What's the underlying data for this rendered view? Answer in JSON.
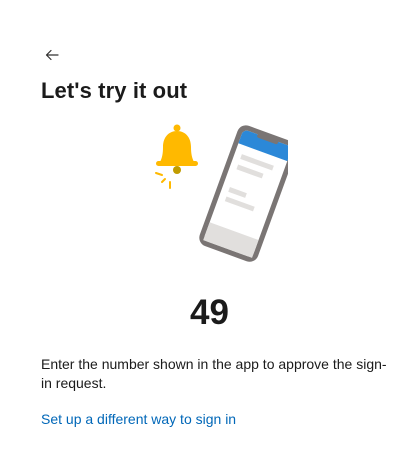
{
  "header": {
    "back_icon": "arrow-left-icon",
    "title": "Let's try it out"
  },
  "illustration": {
    "icons": [
      "bell-icon",
      "phone-icon"
    ],
    "colors": {
      "bell": "#ffb900",
      "phone_frame": "#7a7574",
      "phone_header": "#2b88d8",
      "phone_lines": "#e1dfdd"
    }
  },
  "main": {
    "number": "49",
    "instruction": "Enter the number shown in the app to approve the sign-in request.",
    "alt_link": "Set up a different way to sign in"
  },
  "colors": {
    "link": "#0067b8",
    "text": "#1b1b1b"
  }
}
